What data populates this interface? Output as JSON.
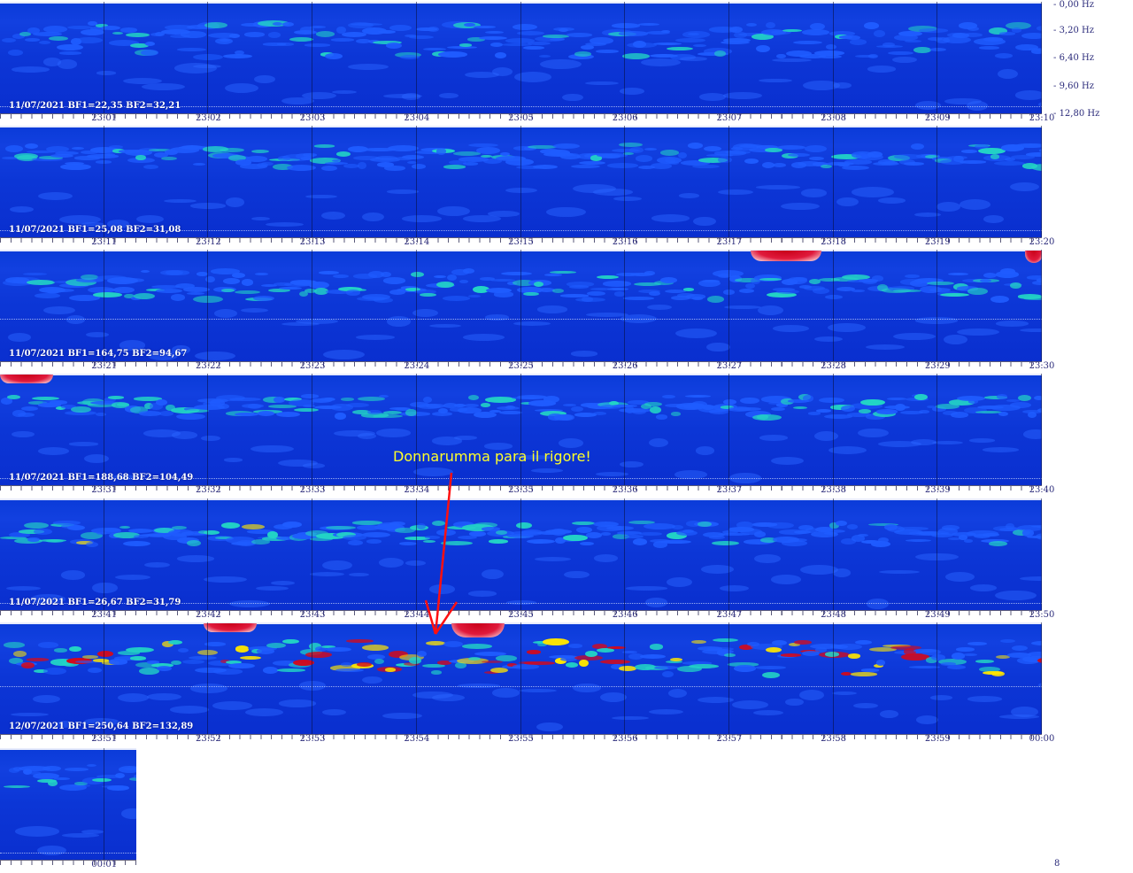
{
  "chart_data": {
    "type": "heatmap",
    "title": "",
    "xlabel": "",
    "ylabel": "",
    "frequency_ticks": [
      "0,00 Hz",
      "3,20 Hz",
      "6,40 Hz",
      "9,60 Hz",
      "12,80 Hz"
    ],
    "rows": [
      {
        "caption": "11/07/2021 BF1=22,35 BF2=32,21",
        "ticks": [
          "23:01",
          "23:02",
          "23:03",
          "23:04",
          "23:05",
          "23:06",
          "23:07",
          "23:08",
          "23:09",
          "23:10"
        ]
      },
      {
        "caption": "11/07/2021 BF1=25,08 BF2=31,08",
        "ticks": [
          "23:11",
          "23:12",
          "23:13",
          "23:14",
          "23:15",
          "23:16",
          "23:17",
          "23:18",
          "23:19",
          "23:20"
        ]
      },
      {
        "caption": "11/07/2021 BF1=164,75 BF2=94,67",
        "ticks": [
          "23:21",
          "23:22",
          "23:23",
          "23:24",
          "23:25",
          "23:26",
          "23:27",
          "23:28",
          "23:29",
          "23:30"
        ]
      },
      {
        "caption": "11/07/2021 BF1=188,68 BF2=104,49",
        "ticks": [
          "23:31",
          "23:32",
          "23:33",
          "23:34",
          "23:35",
          "23:36",
          "23:37",
          "23:38",
          "23:39",
          "23:40"
        ]
      },
      {
        "caption": "11/07/2021 BF1=26,67 BF2=31,79",
        "ticks": [
          "23:41",
          "23:42",
          "23:43",
          "23:44",
          "23:45",
          "23:46",
          "23:47",
          "23:48",
          "23:49",
          "23:50"
        ]
      },
      {
        "caption": "12/07/2021 BF1=250,64 BF2=132,89",
        "ticks": [
          "23:51",
          "23:52",
          "23:53",
          "23:54",
          "23:55",
          "23:56",
          "23:57",
          "23:58",
          "23:59",
          "00:00"
        ]
      },
      {
        "caption": "",
        "ticks": [
          "00:01"
        ]
      }
    ],
    "annotation": {
      "text": "Donnarumma para il rigore!",
      "time": "23:54"
    },
    "page_number": "8",
    "colors": {
      "background": "#0a3bd8",
      "low": "#1f5cff",
      "mid": "#22d3c5",
      "high": "#ffe600",
      "peak": "#d10a1e",
      "annotation_text": "#ffff2a",
      "annotation_arrow": "#ff1010",
      "tick_label": "#2a2a7a"
    }
  }
}
